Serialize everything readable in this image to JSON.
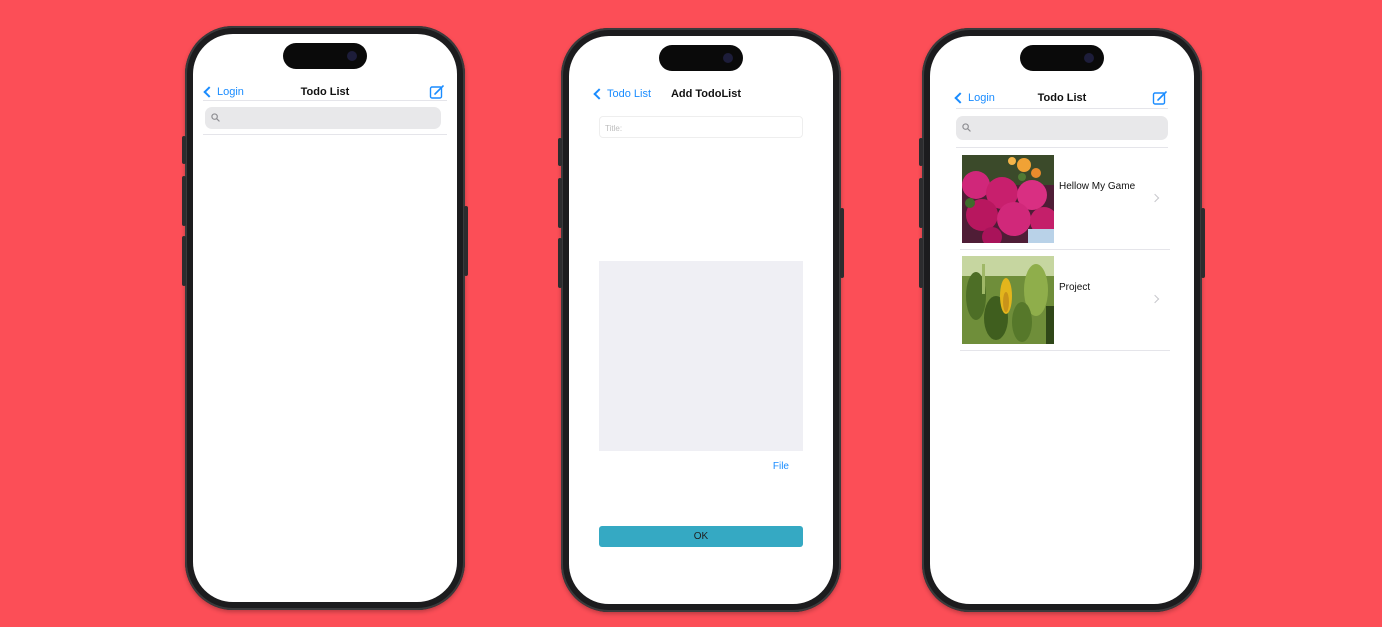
{
  "colors": {
    "background": "#fc4e57",
    "accent": "#1a8cff",
    "ok_button": "#35a9c3"
  },
  "screen1": {
    "nav": {
      "back_label": "Login",
      "title": "Todo List",
      "compose_icon": "compose-icon"
    },
    "search": {
      "placeholder": "",
      "icon": "search-icon"
    }
  },
  "screen2": {
    "nav": {
      "back_label": "Todo List",
      "title": "Add TodoList"
    },
    "title_field": {
      "placeholder": "Title:"
    },
    "image_area": {
      "icon": "image-placeholder"
    },
    "file_label": "File",
    "ok_label": "OK"
  },
  "screen3": {
    "nav": {
      "back_label": "Login",
      "title": "Todo List",
      "compose_icon": "compose-icon"
    },
    "search": {
      "placeholder": "",
      "icon": "search-icon"
    },
    "items": [
      {
        "label": "Hellow My Game",
        "thumb": "flower-photo"
      },
      {
        "label": "Project",
        "thumb": "plant-photo"
      }
    ]
  }
}
